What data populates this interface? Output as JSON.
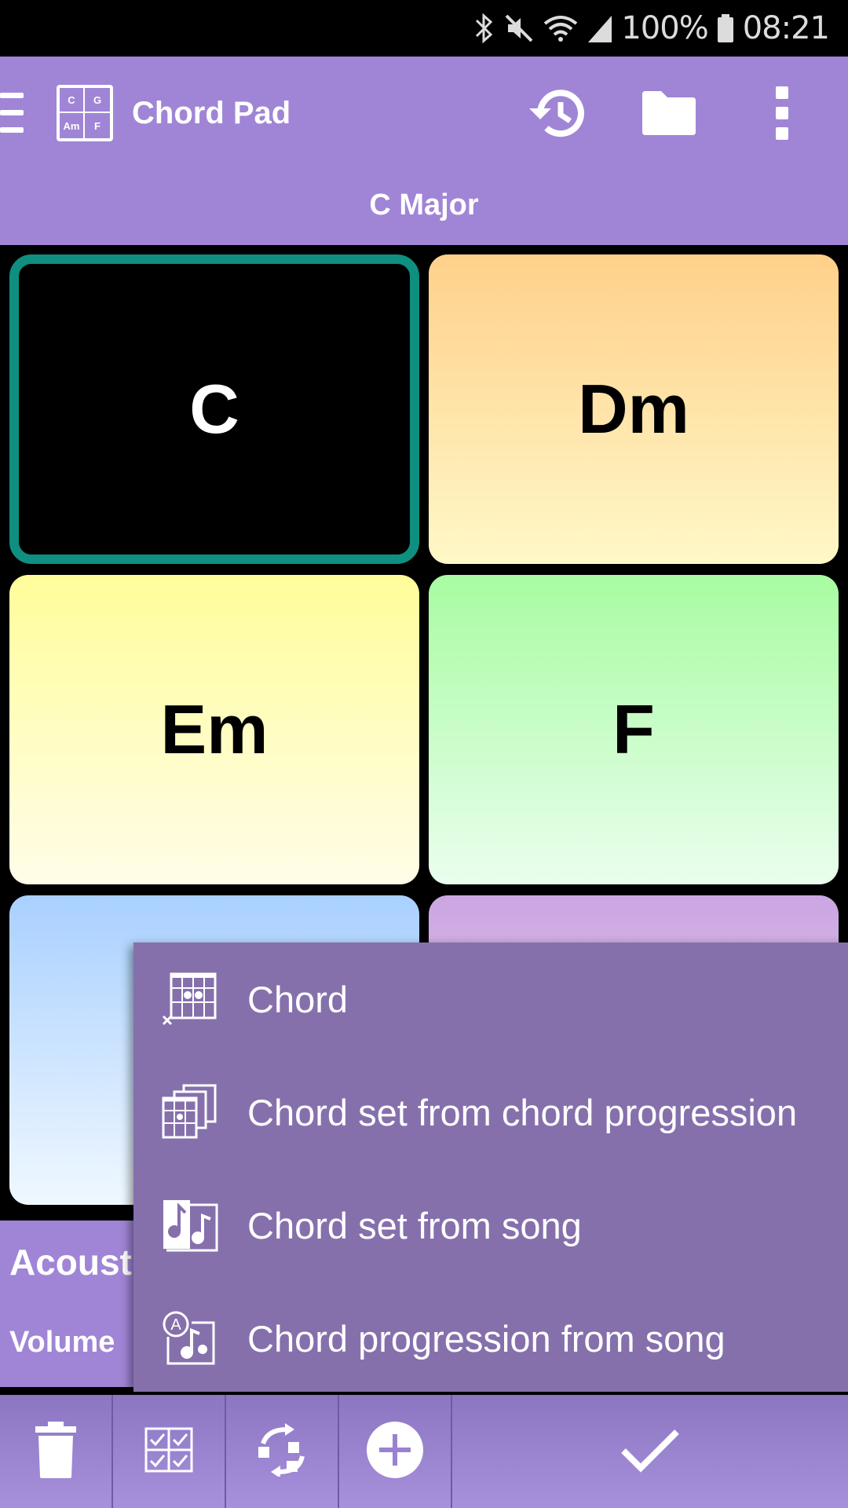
{
  "status_bar": {
    "battery_percent": "100%",
    "time": "08:21",
    "icons": [
      "bluetooth-icon",
      "mute-icon",
      "wifi-icon",
      "signal-icon",
      "battery-icon"
    ]
  },
  "app_bar": {
    "title": "Chord Pad",
    "logo_cells": [
      "C",
      "G",
      "Am",
      "F"
    ],
    "subtitle": "C Major",
    "icons": [
      "menu-icon",
      "history-icon",
      "folder-icon",
      "more-options-icon"
    ]
  },
  "pads": [
    {
      "label": "C",
      "selected": true
    },
    {
      "label": "Dm"
    },
    {
      "label": "Em"
    },
    {
      "label": "F"
    },
    {
      "label": ""
    },
    {
      "label": ""
    }
  ],
  "bottom_panel": {
    "instrument": "Acousti",
    "volume_label": "Volume"
  },
  "popup_menu": {
    "items": [
      {
        "label": "Chord",
        "icon": "chord-diagram-icon"
      },
      {
        "label": "Chord set from chord progression",
        "icon": "chord-set-icon"
      },
      {
        "label": "Chord set from song",
        "icon": "song-icon"
      },
      {
        "label": "Chord progression from song",
        "icon": "progression-song-icon"
      }
    ]
  },
  "toolbar": {
    "icons": [
      "trash-icon",
      "select-all-icon",
      "swap-icon",
      "add-icon",
      "confirm-check-icon"
    ]
  },
  "colors": {
    "app_bar": "#a085d6",
    "popup": "#8570ac",
    "selected_border": "#0e8f80"
  }
}
